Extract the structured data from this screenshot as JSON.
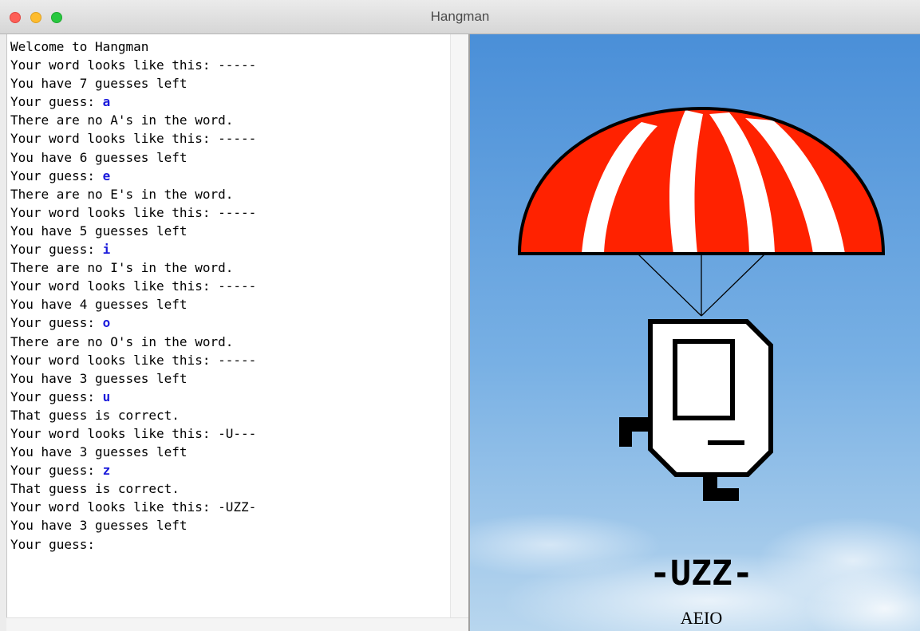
{
  "window": {
    "title": "Hangman"
  },
  "console": {
    "lines": [
      {
        "text": "Welcome to Hangman",
        "guess": ""
      },
      {
        "text": "Your word looks like this: -----",
        "guess": ""
      },
      {
        "text": "You have 7 guesses left",
        "guess": ""
      },
      {
        "text": "Your guess: ",
        "guess": "a"
      },
      {
        "text": "There are no A's in the word.",
        "guess": ""
      },
      {
        "text": "Your word looks like this: -----",
        "guess": ""
      },
      {
        "text": "You have 6 guesses left",
        "guess": ""
      },
      {
        "text": "Your guess: ",
        "guess": "e"
      },
      {
        "text": "There are no E's in the word.",
        "guess": ""
      },
      {
        "text": "Your word looks like this: -----",
        "guess": ""
      },
      {
        "text": "You have 5 guesses left",
        "guess": ""
      },
      {
        "text": "Your guess: ",
        "guess": "i"
      },
      {
        "text": "There are no I's in the word.",
        "guess": ""
      },
      {
        "text": "Your word looks like this: -----",
        "guess": ""
      },
      {
        "text": "You have 4 guesses left",
        "guess": ""
      },
      {
        "text": "Your guess: ",
        "guess": "o"
      },
      {
        "text": "There are no O's in the word.",
        "guess": ""
      },
      {
        "text": "Your word looks like this: -----",
        "guess": ""
      },
      {
        "text": "You have 3 guesses left",
        "guess": ""
      },
      {
        "text": "Your guess: ",
        "guess": "u"
      },
      {
        "text": "That guess is correct.",
        "guess": ""
      },
      {
        "text": "Your word looks like this: -U---",
        "guess": ""
      },
      {
        "text": "You have 3 guesses left",
        "guess": ""
      },
      {
        "text": "Your guess: ",
        "guess": "z"
      },
      {
        "text": "That guess is correct.",
        "guess": ""
      },
      {
        "text": "Your word looks like this: -UZZ-",
        "guess": ""
      },
      {
        "text": "You have 3 guesses left",
        "guess": ""
      },
      {
        "text": "Your guess:",
        "guess": ""
      }
    ]
  },
  "game": {
    "display_word": "-UZZ-",
    "incorrect_guesses": "AEIO"
  },
  "colors": {
    "parachute_red": "#ff2200",
    "sky_top": "#4a8fd8",
    "sky_bottom": "#b8d6ee",
    "guess_blue": "#1a1adb"
  },
  "icons": {
    "close": "close-traffic-light-icon",
    "minimize": "minimize-traffic-light-icon",
    "maximize": "maximize-traffic-light-icon",
    "parachute": "parachute-icon",
    "karel": "karel-robot-icon"
  }
}
